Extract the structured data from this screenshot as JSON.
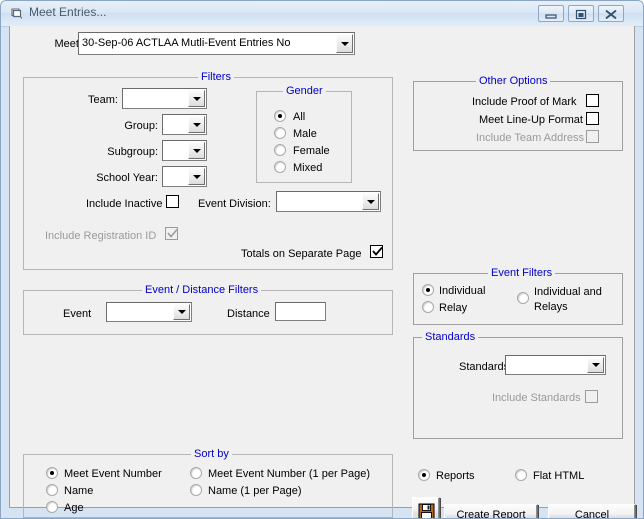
{
  "window": {
    "title": "Meet Entries...",
    "icon": "window-restore-icon",
    "buttons": {
      "minimize": "minimize-icon",
      "maximize": "maximize-icon",
      "close": "close-icon"
    }
  },
  "meet": {
    "label": "Meet:",
    "value": "30-Sep-06 ACTLAA Mutli-Event Entries No"
  },
  "filters": {
    "caption": "Filters",
    "team_label": "Team:",
    "team_value": "",
    "group_label": "Group:",
    "group_value": "",
    "subgroup_label": "Subgroup:",
    "subgroup_value": "",
    "school_year_label": "School Year:",
    "school_year_value": "",
    "include_inactive_label": "Include Inactive",
    "include_inactive_checked": false,
    "event_division_label": "Event Division:",
    "event_division_value": "",
    "include_registration_id_label": "Include Registration ID",
    "include_registration_id_checked": true,
    "include_registration_id_enabled": false,
    "totals_separate_page_label": "Totals on Separate Page",
    "totals_separate_page_checked": true
  },
  "gender": {
    "caption": "Gender",
    "options": [
      {
        "label": "All",
        "selected": true
      },
      {
        "label": "Male",
        "selected": false
      },
      {
        "label": "Female",
        "selected": false
      },
      {
        "label": "Mixed",
        "selected": false
      }
    ]
  },
  "other_options": {
    "caption": "Other Options",
    "items": [
      {
        "label": "Include Proof of Mark",
        "checked": false,
        "enabled": true
      },
      {
        "label": "Meet Line-Up Format",
        "checked": false,
        "enabled": true
      },
      {
        "label": "Include Team Address",
        "checked": false,
        "enabled": false
      }
    ]
  },
  "event_distance_filters": {
    "caption": "Event / Distance Filters",
    "event_label": "Event",
    "event_value": "",
    "distance_label": "Distance",
    "distance_value": ""
  },
  "event_filters": {
    "caption": "Event Filters",
    "options": [
      {
        "label": "Individual",
        "selected": true
      },
      {
        "label": "Relay",
        "selected": false
      },
      {
        "label": "Individual and Relays",
        "selected": false
      }
    ]
  },
  "standards": {
    "caption": "Standards",
    "standards_label": "Standards:",
    "standards_value": "",
    "include_standards_label": "Include Standards",
    "include_standards_checked": false,
    "include_standards_enabled": false
  },
  "sort_by": {
    "caption": "Sort by",
    "options": [
      {
        "label": "Meet Event Number",
        "selected": true
      },
      {
        "label": "Name",
        "selected": false
      },
      {
        "label": "Age",
        "selected": false
      },
      {
        "label": "Meet Event Number (1 per Page)",
        "selected": false
      },
      {
        "label": "Name (1 per Page)",
        "selected": false
      }
    ]
  },
  "output": {
    "options": [
      {
        "label": "Reports",
        "selected": true
      },
      {
        "label": "Flat HTML",
        "selected": false
      }
    ],
    "save_icon": "floppy-disk-save-icon",
    "create_report_label": "Create Report",
    "cancel_label": "Cancel"
  },
  "colors": {
    "group_caption": "#0000c8",
    "window_frame": "#d6e3f2",
    "client_bg": "#f0f0f0",
    "disabled_text": "#9a9a9a"
  }
}
